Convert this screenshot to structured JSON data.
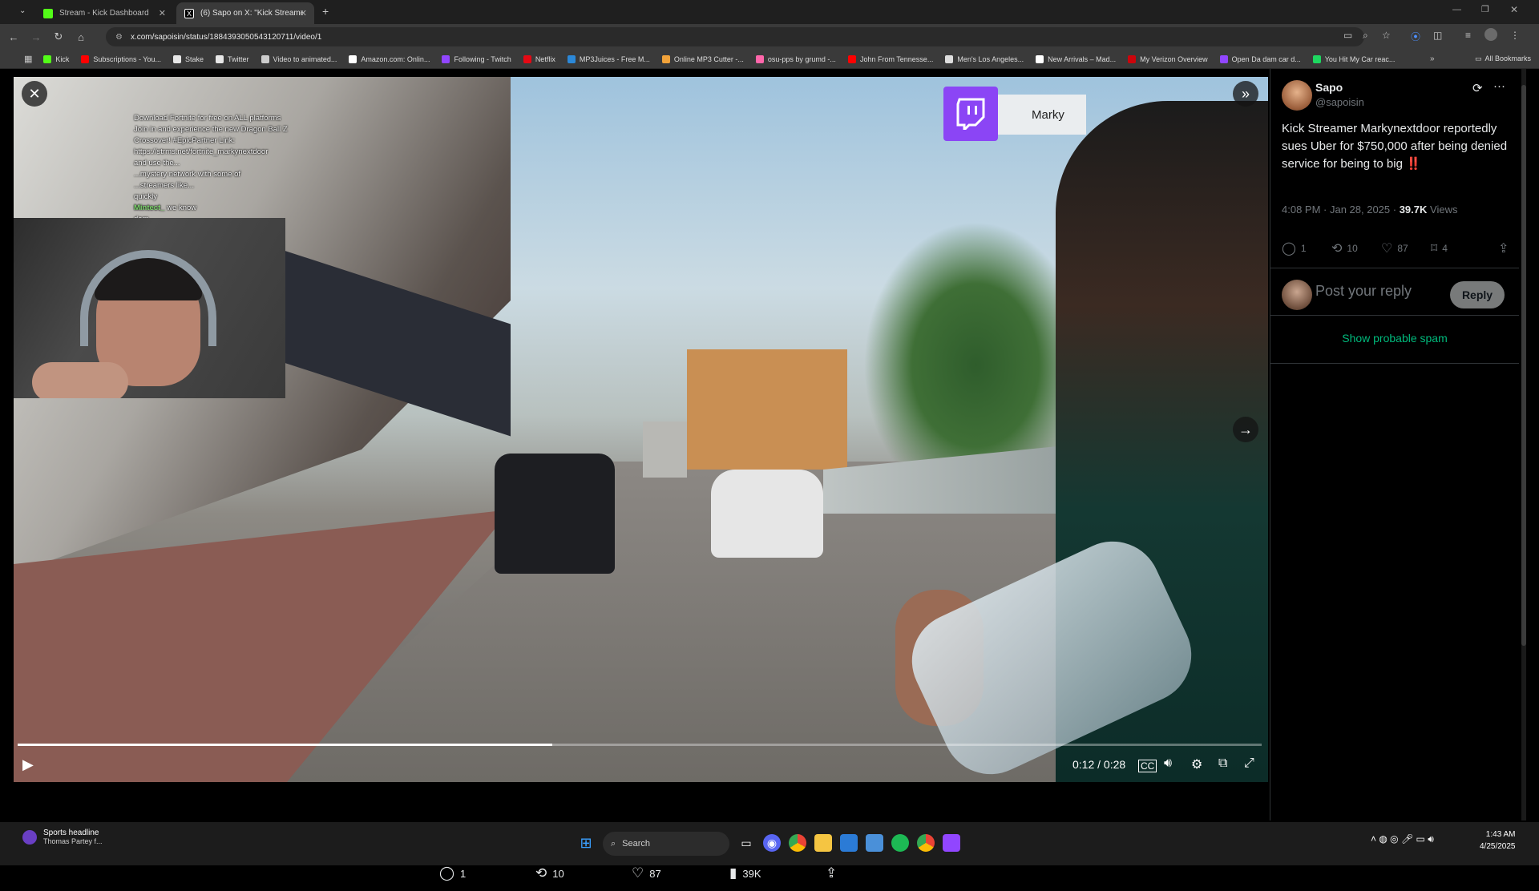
{
  "browser": {
    "tabs": [
      {
        "label": "Stream - Kick Dashboard",
        "active": false,
        "favicon_color": "#53fc18"
      },
      {
        "label": "(6) Sapo on X: \"Kick Streamer M",
        "active": true,
        "favicon_color": "#ffffff"
      }
    ],
    "url": "x.com/sapoisin/status/1884393050543120711/video/1",
    "bookmarks": [
      {
        "label": "Kick",
        "color": "#53fc18"
      },
      {
        "label": "Subscriptions - You...",
        "color": "#ff0000"
      },
      {
        "label": "Stake",
        "color": "#e7e7e7"
      },
      {
        "label": "Twitter",
        "color": "#e7e7e7"
      },
      {
        "label": "Video to animated...",
        "color": "#cccccc"
      },
      {
        "label": "Amazon.com: Onlin...",
        "color": "#ffffff"
      },
      {
        "label": "Following - Twitch",
        "color": "#9146ff"
      },
      {
        "label": "Netflix",
        "color": "#e50914"
      },
      {
        "label": "MP3Juices - Free M...",
        "color": "#2b88d8"
      },
      {
        "label": "Online MP3 Cutter -...",
        "color": "#f2a33a"
      },
      {
        "label": "osu-pps by grumd -...",
        "color": "#ff66aa"
      },
      {
        "label": "John From Tennesse...",
        "color": "#ff0000"
      },
      {
        "label": "Men's Los Angeles...",
        "color": "#dddddd"
      },
      {
        "label": "New Arrivals – Mad...",
        "color": "#ffffff"
      },
      {
        "label": "My Verizon Overview",
        "color": "#cd040b"
      },
      {
        "label": "Open Da dam car d...",
        "color": "#9146ff"
      },
      {
        "label": "You Hit My Car reac...",
        "color": "#1ed760"
      }
    ],
    "all_bookmarks": "All Bookmarks"
  },
  "stream_overlay": {
    "chat": [
      {
        "name": "",
        "text": "Download Fortnite for free on ALL platforms"
      },
      {
        "name": "",
        "text": "Join in and experience the new Dragon Ball Z"
      },
      {
        "name": "",
        "text": "Crossover! #EpicPartner Link:"
      },
      {
        "name": "",
        "text": "https://strms.net/fortnite_markynextdoor"
      },
      {
        "name": "",
        "text": "and use the..."
      },
      {
        "name": "",
        "text": "...mystery network with some of"
      },
      {
        "name": "",
        "text": "...streamers like..."
      },
      {
        "name": "",
        "text": "quickly"
      },
      {
        "name": "Mintect_",
        "text": " we know"
      },
      {
        "name": "",
        "text": "dam"
      }
    ],
    "twitch_name": "Marky"
  },
  "video": {
    "time": "0:12 / 0:28",
    "progress": 0.43
  },
  "actions": {
    "replies": "1",
    "reposts": "10",
    "likes": "87",
    "views": "39K"
  },
  "post": {
    "author_name": "Sapo",
    "author_handle": "@sapoisin",
    "text": "Kick Streamer Markynextdoor reportedly sues Uber for $750,000 after being denied service for being to big",
    "emoji": "‼️",
    "time": "4:08 PM · Jan 28, 2025 · ",
    "views_count": "39.7K",
    "views_label": " Views",
    "stats": {
      "replies": "1",
      "reposts": "10",
      "likes": "87",
      "bookmarks": "4"
    },
    "reply_placeholder": "Post your reply",
    "reply_button": "Reply",
    "spam_link": "Show probable spam"
  },
  "taskbar": {
    "widget_title": "Sports headline",
    "widget_sub": "Thomas Partey f...",
    "search": "Search",
    "clock_time": "1:43 AM",
    "clock_date": "4/25/2025"
  }
}
